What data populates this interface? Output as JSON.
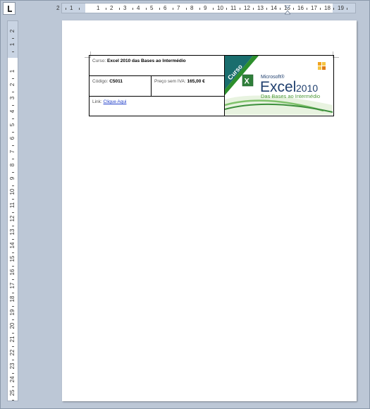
{
  "rulers": {
    "horizontal_ticks": [
      "2",
      "1",
      "1",
      "2",
      "3",
      "4",
      "5",
      "6",
      "7",
      "8",
      "9",
      "10",
      "11",
      "12",
      "13",
      "14",
      "15",
      "16",
      "17",
      "18",
      "19"
    ],
    "vertical_ticks": [
      "2",
      "1",
      "1",
      "2",
      "3",
      "4",
      "5",
      "6",
      "7",
      "8",
      "9",
      "10",
      "11",
      "12",
      "13",
      "14",
      "15",
      "16",
      "17",
      "18",
      "19",
      "20",
      "21",
      "22",
      "23",
      "24",
      "25"
    ]
  },
  "course": {
    "curso_label": "Curso:",
    "curso_value": "Excel 2010 das Bases ao Intermédio",
    "codigo_label": "Código:",
    "codigo_value": "C5011",
    "preco_label": "Preço sem IVA:",
    "preco_value": "165,00 €",
    "link_label": "Link:",
    "link_text": "Clique  Aqui"
  },
  "logo": {
    "ribbon_text": "Curso",
    "brand": "Microsoft®",
    "product": "Excel",
    "version": "2010",
    "subtitle": "Das Bases ao Intermédio",
    "colors": {
      "teal": "#1a6e6e",
      "green": "#2c8f2c",
      "text": "#1f3f6e",
      "subtitle": "#4f9a3a"
    }
  }
}
